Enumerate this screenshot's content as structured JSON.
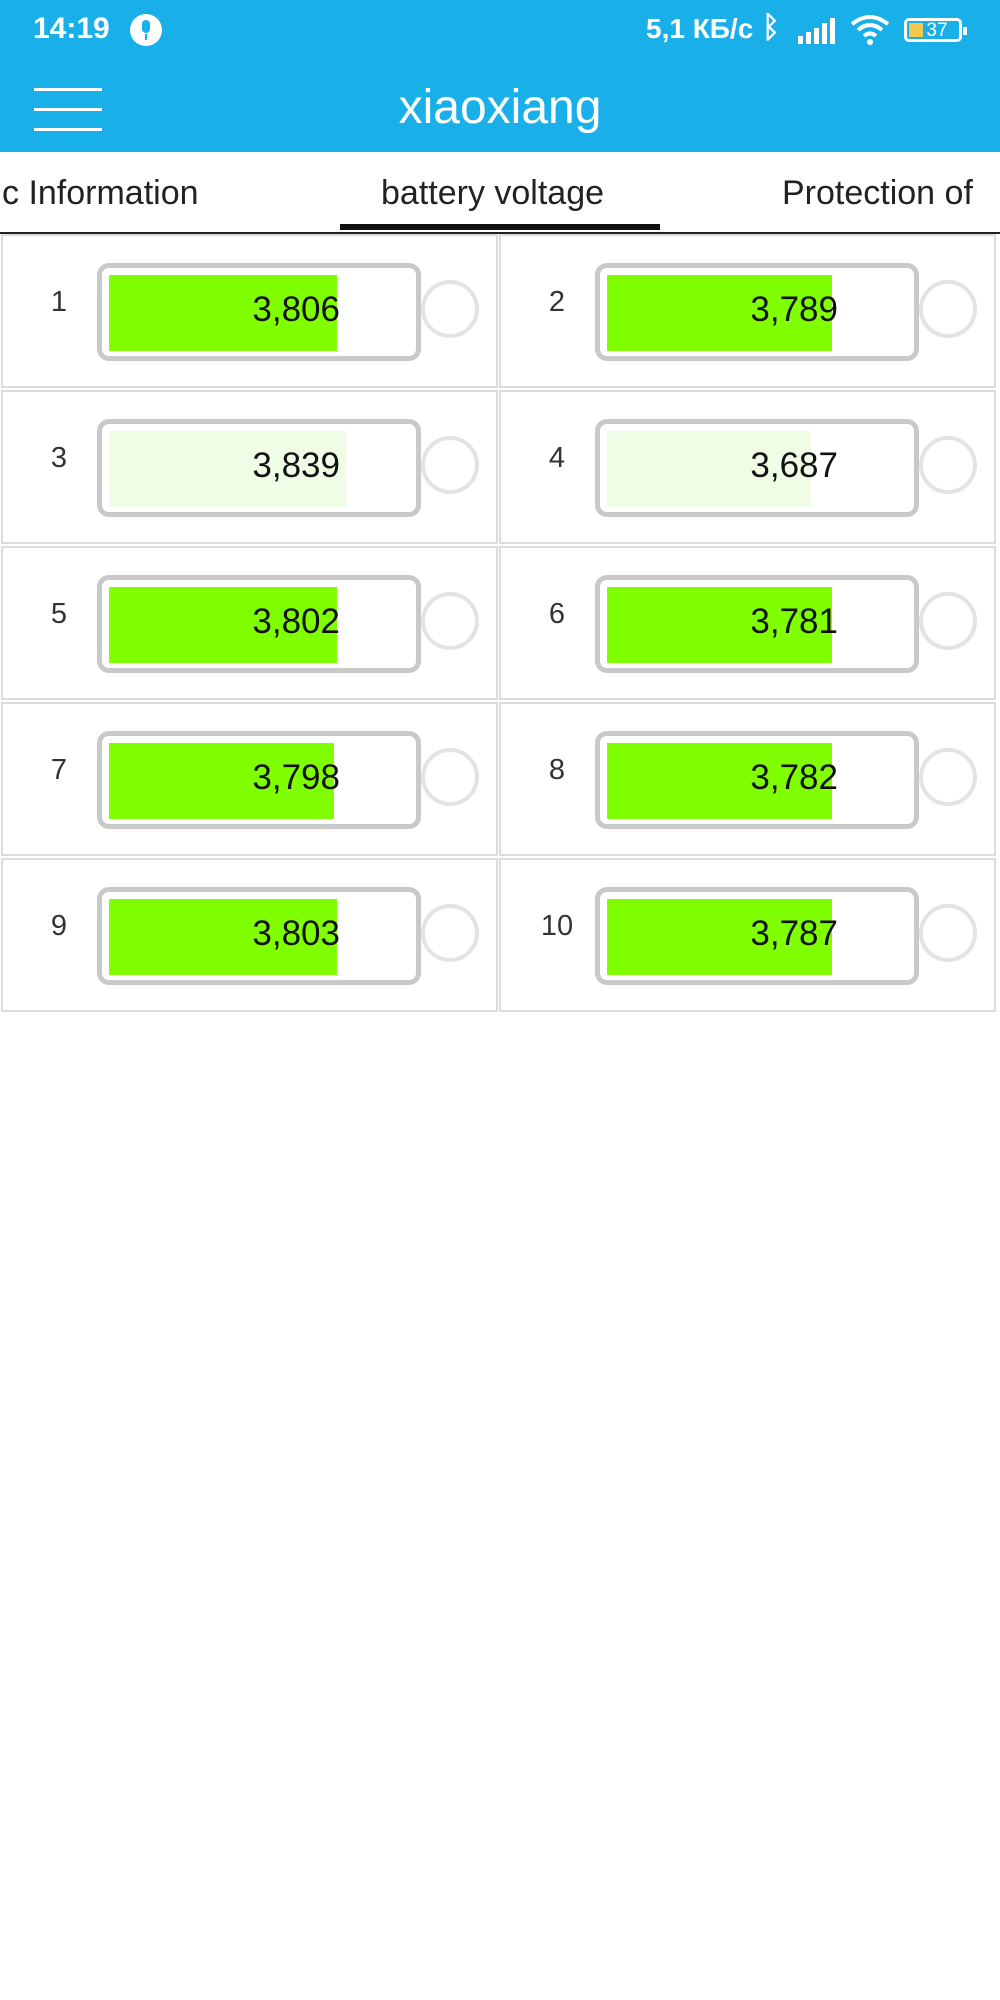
{
  "status_bar": {
    "time": "14:19",
    "net_speed": "5,1 КБ/с",
    "battery_level": "37",
    "icons": [
      "mic-icon",
      "bluetooth-icon",
      "signal-icon",
      "wifi-icon",
      "battery-icon"
    ]
  },
  "app_bar": {
    "title": "xiaoxiang",
    "menu_icon": "hamburger-menu-icon"
  },
  "tabs": [
    {
      "label": "c Information",
      "selected": false
    },
    {
      "label": "battery voltage",
      "selected": true
    },
    {
      "label": "Protection of",
      "selected": false
    }
  ],
  "cells": [
    {
      "index": "1",
      "voltage": "3,806",
      "fill": 0.76,
      "style": "green"
    },
    {
      "index": "2",
      "voltage": "3,789",
      "fill": 0.75,
      "style": "green"
    },
    {
      "index": "3",
      "voltage": "3,839",
      "fill": 0.79,
      "style": "light"
    },
    {
      "index": "4",
      "voltage": "3,687",
      "fill": 0.68,
      "style": "light"
    },
    {
      "index": "5",
      "voltage": "3,802",
      "fill": 0.76,
      "style": "green"
    },
    {
      "index": "6",
      "voltage": "3,781",
      "fill": 0.75,
      "style": "green"
    },
    {
      "index": "7",
      "voltage": "3,798",
      "fill": 0.75,
      "style": "green"
    },
    {
      "index": "8",
      "voltage": "3,782",
      "fill": 0.75,
      "style": "green"
    },
    {
      "index": "9",
      "voltage": "3,803",
      "fill": 0.76,
      "style": "green"
    },
    {
      "index": "10",
      "voltage": "3,787",
      "fill": 0.75,
      "style": "green"
    }
  ],
  "colors": {
    "accent": "#19b0ea",
    "cell_green": "#7fff00",
    "cell_light": "#effde6",
    "border": "#c9c9c9"
  }
}
